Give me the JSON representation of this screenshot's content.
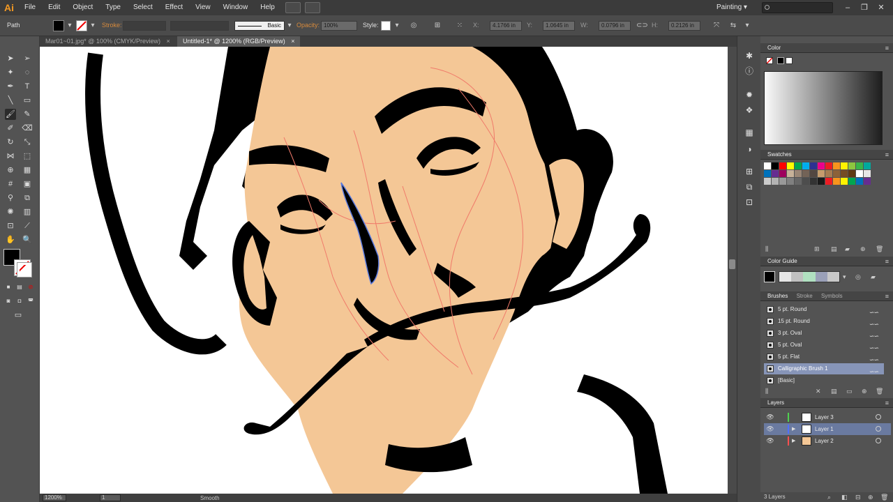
{
  "app": {
    "logo": "Ai",
    "menus": [
      "File",
      "Edit",
      "Object",
      "Type",
      "Select",
      "Effect",
      "View",
      "Window",
      "Help"
    ],
    "workspace": "Painting",
    "window_controls": [
      "–",
      "❐",
      "✕"
    ]
  },
  "control_bar": {
    "selection_label": "Path",
    "stroke_label": "Stroke:",
    "brush_style": "Basic",
    "opacity_label": "Opacity:",
    "opacity_value": "100%",
    "style_label": "Style:",
    "x_label": "X:",
    "x_value": "4.1766 in",
    "y_label": "Y:",
    "y_value": "1.0645 in",
    "w_label": "W:",
    "w_value": "0.0796 in",
    "h_label": "H:",
    "h_value": "0.2126 in"
  },
  "tabs": [
    {
      "label": "Mar01~01.jpg* @ 100% (CMYK/Preview)",
      "active": false
    },
    {
      "label": "Untitled-1* @ 1200% (RGB/Preview)",
      "active": true
    }
  ],
  "tab_close": "×",
  "status_bar": {
    "zoom": "1200%",
    "artboard": "1",
    "tool_name": "Smooth"
  },
  "panels": {
    "color": {
      "title": "Color"
    },
    "swatches": {
      "title": "Swatches"
    },
    "color_guide": {
      "title": "Color Guide"
    },
    "brushes": {
      "tabs": [
        "Brushes",
        "Stroke",
        "Symbols"
      ],
      "items": [
        {
          "name": "5 pt. Round",
          "selected": false
        },
        {
          "name": "15 pt. Round",
          "selected": false
        },
        {
          "name": "3 pt. Oval",
          "selected": false
        },
        {
          "name": "5 pt. Oval",
          "selected": false
        },
        {
          "name": "5 pt. Flat",
          "selected": false
        },
        {
          "name": "Calligraphic Brush 1",
          "selected": true
        },
        {
          "name": "[Basic]",
          "selected": false
        }
      ]
    },
    "layers": {
      "title": "Layers",
      "items": [
        {
          "name": "Layer 3",
          "color": "#4fd14f",
          "selected": false
        },
        {
          "name": "Layer 1",
          "color": "#4f6fff",
          "selected": true
        },
        {
          "name": "Layer 2",
          "color": "#ff4f4f",
          "selected": false
        }
      ],
      "footer": "3 Layers"
    }
  },
  "colors": {
    "skin": "#f4c796",
    "ink": "#000000",
    "path_guide": "#f07a6a",
    "selection_path": "#5a7adf",
    "accent_orange": "#f59a23"
  },
  "swatch_colors": [
    "#ffffff",
    "#000000",
    "#ff0000",
    "#ffff00",
    "#00a651",
    "#00aeef",
    "#2e3192",
    "#ec008c",
    "#ed1c24",
    "#f7941d",
    "#fff200",
    "#8dc63f",
    "#39b54a",
    "#00a99d",
    "#0072bc",
    "#662d91",
    "#9e005d",
    "#c7b299",
    "#998675",
    "#736357",
    "#534741",
    "#c69c6d",
    "#a67c52",
    "#8c6239",
    "#754c24",
    "#603913",
    "#ffffff",
    "#e6e6e6",
    "#cccccc",
    "#b3b3b3",
    "#999999",
    "#808080",
    "#666666",
    "#4d4d4d",
    "#333333",
    "#1a1a1a",
    "#ed1c24",
    "#f7941d",
    "#fff200",
    "#00a651",
    "#0072bc",
    "#662d91"
  ]
}
